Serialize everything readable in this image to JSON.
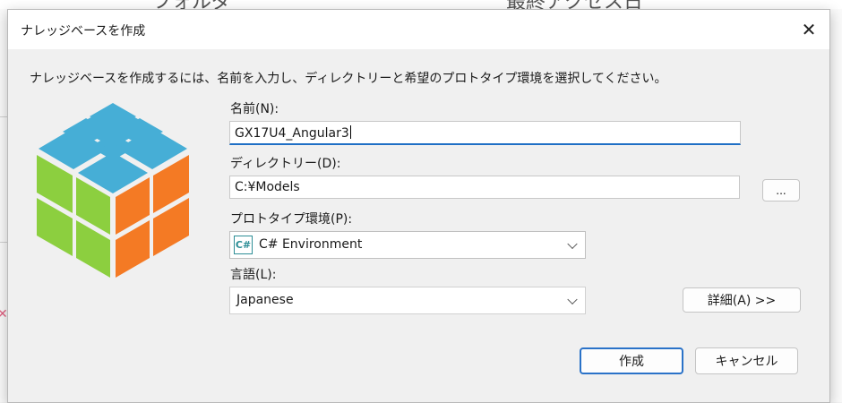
{
  "background": {
    "columns": [
      "フォルダ",
      "最終アクセス日"
    ]
  },
  "dialog": {
    "title": "ナレッジベースを作成",
    "description": "ナレッジベースを作成するには、名前を入力し、ディレクトリーと希望のプロトタイプ環境を選択してください。",
    "name": {
      "label": "名前(N):",
      "value": "GX17U4_Angular3"
    },
    "directory": {
      "label": "ディレクトリー(D):",
      "value": "C:¥Models",
      "browse_label": "..."
    },
    "environment": {
      "label": "プロトタイプ環境(P):",
      "selected": "C# Environment",
      "icon_text": "C#"
    },
    "language": {
      "label": "言語(L):",
      "selected": "Japanese"
    },
    "details_label": "詳細(A) >>",
    "create_label": "作成",
    "cancel_label": "キャンセル"
  },
  "colors": {
    "accent": "#1f6fc5",
    "cube_top": "#46aed6",
    "cube_left": "#8ccf3f",
    "cube_right": "#f47a24"
  },
  "icons": [
    "close-icon",
    "rubiks-cube-icon",
    "csharp-icon",
    "chevron-down-icon"
  ]
}
